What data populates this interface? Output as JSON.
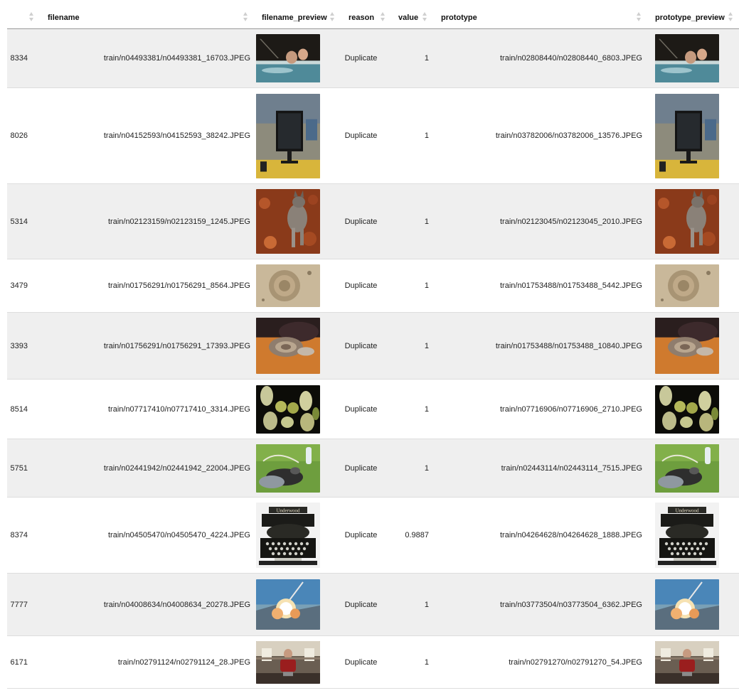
{
  "columns": {
    "index": "",
    "filename": "filename",
    "filename_preview": "filename_preview",
    "reason": "reason",
    "value": "value",
    "prototype": "prototype",
    "prototype_preview": "prototype_preview"
  },
  "rows": [
    {
      "index": "8334",
      "filename": "train/n04493381/n04493381_16703.JPEG",
      "reason": "Duplicate",
      "value": "1",
      "prototype": "train/n02808440/n02808440_6803.JPEG",
      "preview": "hot-tub-image"
    },
    {
      "index": "8026",
      "filename": "train/n04152593/n04152593_38242.JPEG",
      "reason": "Duplicate",
      "value": "1",
      "prototype": "train/n03782006/n03782006_13576.JPEG",
      "preview": "computer-monitor-image"
    },
    {
      "index": "5314",
      "filename": "train/n02123159/n02123159_1245.JPEG",
      "reason": "Duplicate",
      "value": "1",
      "prototype": "train/n02123045/n02123045_2010.JPEG",
      "preview": "tabby-cat-image"
    },
    {
      "index": "3479",
      "filename": "train/n01756291/n01756291_8564.JPEG",
      "reason": "Duplicate",
      "value": "1",
      "prototype": "train/n01753488/n01753488_5442.JPEG",
      "preview": "coiled-snake-sand-image"
    },
    {
      "index": "3393",
      "filename": "train/n01756291/n01756291_17393.JPEG",
      "reason": "Duplicate",
      "value": "1",
      "prototype": "train/n01753488/n01753488_10840.JPEG",
      "preview": "snake-on-cloth-image"
    },
    {
      "index": "8514",
      "filename": "train/n07717410/n07717410_3314.JPEG",
      "reason": "Duplicate",
      "value": "1",
      "prototype": "train/n07716906/n07716906_2710.JPEG",
      "preview": "squash-vegetables-image"
    },
    {
      "index": "5751",
      "filename": "train/n02441942/n02441942_22004.JPEG",
      "reason": "Duplicate",
      "value": "1",
      "prototype": "train/n02443114/n02443114_7515.JPEG",
      "preview": "animal-on-grass-image"
    },
    {
      "index": "8374",
      "filename": "train/n04505470/n04505470_4224.JPEG",
      "reason": "Duplicate",
      "value": "0.9887",
      "prototype": "train/n04264628/n04264628_1888.JPEG",
      "preview": "typewriter-image",
      "label": "Underwood"
    },
    {
      "index": "7777",
      "filename": "train/n04008634/n04008634_20278.JPEG",
      "reason": "Duplicate",
      "value": "1",
      "prototype": "train/n03773504/n03773504_6362.JPEG",
      "preview": "missile-launch-image"
    },
    {
      "index": "6171",
      "filename": "train/n02791124/n02791124_28.JPEG",
      "reason": "Duplicate",
      "value": "1",
      "prototype": "train/n02791270/n02791270_54.JPEG",
      "preview": "barber-chair-image"
    }
  ]
}
